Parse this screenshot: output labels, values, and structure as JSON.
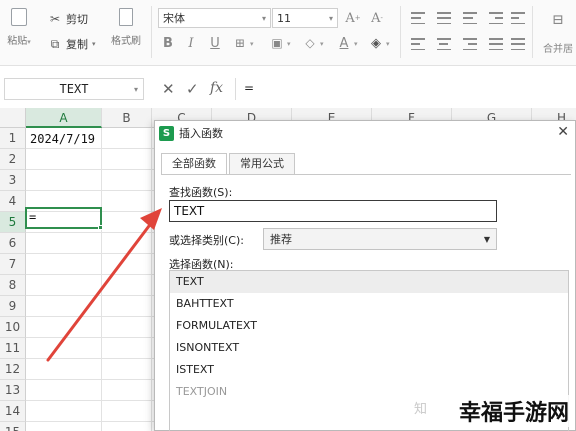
{
  "ribbon": {
    "paste_label": "粘贴",
    "cut_label": "剪切",
    "copy_label": "复制",
    "format_painter_label": "格式刷",
    "font_name": "宋体",
    "font_size": "11",
    "merge_label": "合并居"
  },
  "formula_bar": {
    "name_box": "TEXT",
    "cancel_glyph": "✕",
    "enter_glyph": "✓",
    "fx_label": "fx",
    "content": "="
  },
  "grid": {
    "columns": [
      "A",
      "B",
      "C",
      "D",
      "E",
      "F",
      "G",
      "H"
    ],
    "rows": [
      "1",
      "2",
      "3",
      "4",
      "5",
      "6",
      "7",
      "8",
      "9",
      "10",
      "11",
      "12",
      "13",
      "14",
      "15"
    ],
    "cell_a1": "2024/7/19",
    "cell_a5": "=",
    "active_color": "#2f8f4e"
  },
  "dialog": {
    "logo": "S",
    "title": "插入函数",
    "close": "✕",
    "tabs": [
      "全部函数",
      "常用公式"
    ],
    "search_label": "查找函数(S):",
    "search_value": "TEXT",
    "category_label": "或选择类别(C):",
    "category_value": "推荐",
    "list_label": "选择函数(N):",
    "functions": [
      "TEXT",
      "BAHTTEXT",
      "FORMULATEXT",
      "ISNONTEXT",
      "ISTEXT",
      "TEXTJOIN"
    ]
  },
  "watermark": {
    "text": "幸福手游网",
    "faint": "知"
  },
  "colors": {
    "arrow": "#e0443a",
    "accent_green": "#1d9b4f"
  }
}
